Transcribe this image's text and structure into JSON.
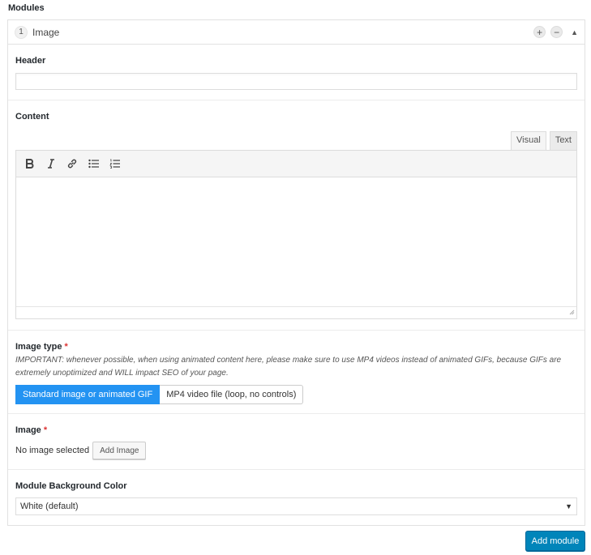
{
  "section": {
    "title": "Modules"
  },
  "module": {
    "number": "1",
    "name": "Image",
    "plus_icon": "plus-icon",
    "minus_icon": "minus-icon",
    "collapse_icon": "triangle-up-icon"
  },
  "fields": {
    "header": {
      "label": "Header",
      "value": ""
    },
    "content": {
      "label": "Content",
      "tabs": [
        {
          "label": "Visual",
          "active": true
        },
        {
          "label": "Text",
          "active": false
        }
      ],
      "toolbar": [
        "bold-icon",
        "italic-icon",
        "link-icon",
        "bullet-list-icon",
        "numbered-list-icon"
      ]
    },
    "image_type": {
      "label": "Image type",
      "required_mark": "*",
      "note": "IMPORTANT: whenever possible, when using animated content here, please make sure to use MP4 videos instead of animated GIFs, because GIFs are extremely unoptimized and WILL impact SEO of your page.",
      "options": [
        {
          "label": "Standard image or animated GIF",
          "selected": true
        },
        {
          "label": "MP4 video file (loop, no controls)",
          "selected": false
        }
      ]
    },
    "image": {
      "label": "Image",
      "required_mark": "*",
      "status": "No image selected",
      "button": "Add Image"
    },
    "background": {
      "label": "Module Background Color",
      "selected": "White (default)"
    }
  },
  "actions": {
    "add_module": "Add module"
  },
  "colors": {
    "primary": "#0085ba",
    "selected_option": "#2393f2",
    "required": "#dc3232"
  }
}
